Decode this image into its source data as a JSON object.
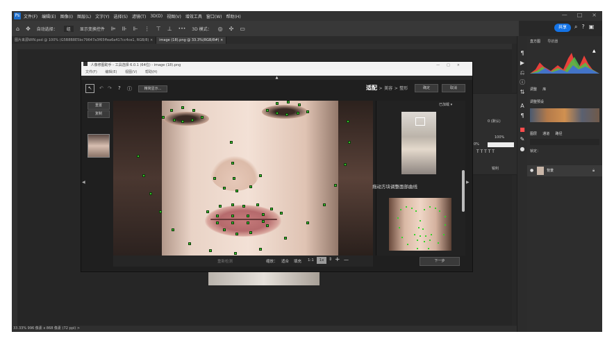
{
  "photoshop": {
    "menubar": {
      "logo": "Ps",
      "items": [
        "文件(F)",
        "编辑(E)",
        "图像(I)",
        "图层(L)",
        "文字(Y)",
        "选择(S)",
        "滤镜(T)",
        "3D(D)",
        "视图(V)",
        "增效工具",
        "窗口(W)",
        "帮助(H)"
      ],
      "window_buttons": [
        "—",
        "□",
        "×"
      ]
    },
    "options_bar": {
      "home_icon": "home-icon",
      "move_icon": "move-icon",
      "auto_select_label": "自动选择：",
      "auto_select_value": "组",
      "show_transform_label": "显示变换控件",
      "mode_3d_label": "3D 模式：",
      "more_label": "•••",
      "share_label": "共享"
    },
    "tabs": [
      {
        "label": "图片来源WIN.psd @ 100% (G5B8B8E5bc79647a3f65ffea6a417cc4ce1, RGB/8) ×",
        "active": false
      },
      {
        "label": "image (18).png @ 33.3%(RGB/8#) ×",
        "active": true
      }
    ],
    "status_bar": {
      "text": "33.33%   996 像素 x 868 像素 (72 ppi)   >"
    },
    "right_panel": {
      "tabs": [
        "直方图",
        "导航器"
      ],
      "props_tabs": [
        "调整",
        "库"
      ],
      "adjust_label": "调整预设",
      "layers_tabs": [
        "图层",
        "通道",
        "路径"
      ],
      "layer_name": "背景",
      "lock_label": "锁定："
    },
    "char_panel": {
      "size": "100%",
      "opacity": "0%",
      "font_value": "0 (默认)",
      "mode": "锐利"
    }
  },
  "plugin": {
    "title": "人像修图助手 - 工具选择 6.0.1 (64位) - image (18).png",
    "menu": [
      "文件(F)",
      "编辑(E)",
      "视图(V)",
      "帮助(H)"
    ],
    "toolbar": {
      "help_label": "?",
      "info_label": "ⓘ",
      "license_label": "精简显示..."
    },
    "steps": {
      "fit": "适配",
      "sep1": ">",
      "beautify": "美容",
      "sep2": ">",
      "shape": "整形"
    },
    "confirm_label": "确定",
    "cancel_label": "取消",
    "left_buttons": [
      "重置",
      "复制"
    ],
    "right_panel": {
      "dropdown_label": "已加载 ▾",
      "hint_text": "拖动方块调整面部曲线"
    },
    "bottom_bar": {
      "center_label": "重新检测",
      "zoom_label": "缩放：",
      "fit_label": "适合",
      "fill_label": "填充",
      "ratio_label": "1:1",
      "zoom_value": "1x",
      "plus_label": "+",
      "minus_label": "—",
      "next_label": "下一步"
    }
  }
}
